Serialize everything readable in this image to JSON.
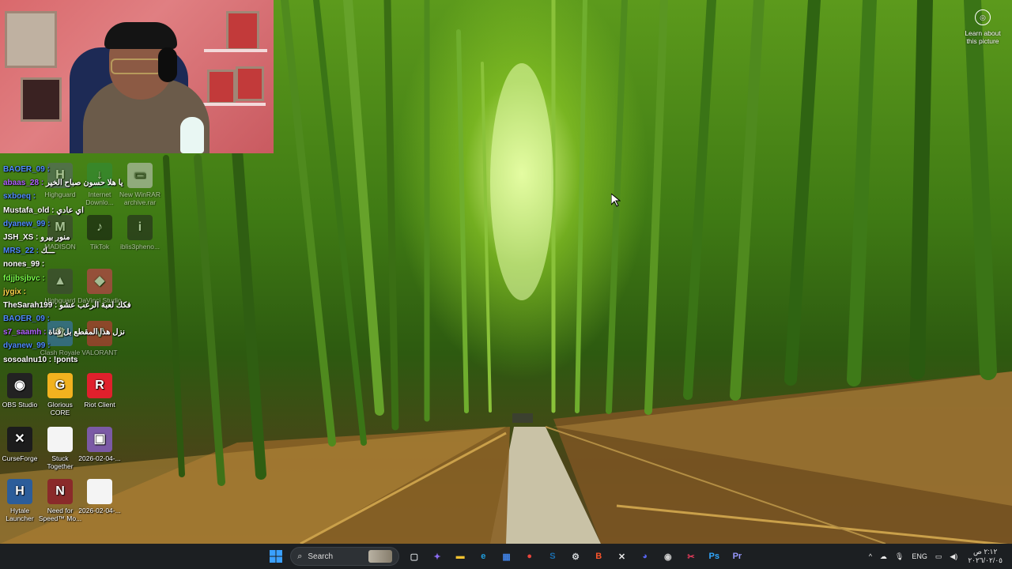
{
  "learn_about": {
    "label_line1": "Learn about",
    "label_line2": "this picture"
  },
  "chat": [
    {
      "user": "BAOER_09 :",
      "msg": "",
      "color": "#4f8bff"
    },
    {
      "user": "abaas_28 :",
      "msg": "يا هلا حسون صباح الخير",
      "color": "#b061ff"
    },
    {
      "user": "sxboeq :",
      "msg": "",
      "color": "#4f8bff"
    },
    {
      "user": "Mustafa_old :",
      "msg": "اي عادي",
      "color": "#ffffff"
    },
    {
      "user": "dyanew_99 :",
      "msg": "",
      "color": "#4f8bff"
    },
    {
      "user": "JSH_XS :",
      "msg": "منور بيرو",
      "color": "#ffffff"
    },
    {
      "user": "MRS_22 :",
      "msg": "ـــك",
      "color": "#4f8bff"
    },
    {
      "user": "nones_99 :",
      "msg": "",
      "color": "#ffffff"
    },
    {
      "user": "fdjjbsjbvc :",
      "msg": "",
      "color": "#7cff4a"
    },
    {
      "user": "jygix :",
      "msg": "",
      "color": "#ffd34a"
    },
    {
      "user": "TheSarah199 :",
      "msg": "فكك لعبة الرعب عشو",
      "color": "#ffffff"
    },
    {
      "user": "BAOER_09 :",
      "msg": "",
      "color": "#4f8bff"
    },
    {
      "user": "s7_saamh :",
      "msg": "نزل هذا المقطع بل قناة",
      "color": "#b061ff"
    },
    {
      "user": "dyanew_99 :",
      "msg": "",
      "color": "#4f8bff"
    },
    {
      "user": "sosoalnu10 :",
      "msg": "!ponts",
      "color": "#ffffff"
    }
  ],
  "desktop_icons": [
    {
      "label": "Highguard",
      "color": "#5a6470",
      "glyph": "H"
    },
    {
      "label": "Internet Downlo...",
      "color": "#2e8c3a",
      "glyph": "↓"
    },
    {
      "label": "New WinRAR archive.rar",
      "color": "#cfcfcf",
      "glyph": "▭"
    },
    {
      "label": "MADISON",
      "color": "#3a3a3a",
      "glyph": "M"
    },
    {
      "label": "TikTok",
      "color": "#111111",
      "glyph": "♪"
    },
    {
      "label": "iblis3pheno...",
      "color": "#202020",
      "glyph": "i"
    },
    {
      "label": "Highguard",
      "color": "#3f3f3f",
      "glyph": "▲"
    },
    {
      "label": "DaVinci Studio",
      "color": "#e23a5a",
      "glyph": "◆"
    },
    {
      "label": "Clash Royale",
      "color": "#3a7ad0",
      "glyph": "♛"
    },
    {
      "label": "VALORANT",
      "color": "#d8343f",
      "glyph": "V"
    },
    {
      "label": "OBS Studio",
      "color": "#222222",
      "glyph": "◉"
    },
    {
      "label": "Glorious CORE",
      "color": "#f2b21f",
      "glyph": "G"
    },
    {
      "label": "Riot Client",
      "color": "#e0202c",
      "glyph": "R"
    },
    {
      "label": "CurseForge",
      "color": "#1c1c1c",
      "glyph": "✕"
    },
    {
      "label": "Stuck Together",
      "color": "#f4f4f4",
      "glyph": ""
    },
    {
      "label": "2026-02-04-...",
      "color": "#7b5aa6",
      "glyph": "▣"
    },
    {
      "label": "Hytale Launcher",
      "color": "#2c5d9a",
      "glyph": "H"
    },
    {
      "label": "Need for Speed™ Mo...",
      "color": "#8a2a2a",
      "glyph": "N"
    },
    {
      "label": "2026-02-04-...",
      "color": "#f4f4f4",
      "glyph": ""
    }
  ],
  "taskbar": {
    "search_placeholder": "Search",
    "apps": [
      {
        "name": "task-view",
        "color": "#cfd3d6",
        "glyph": "▢"
      },
      {
        "name": "copilot",
        "color": "#8b6cf0",
        "glyph": "✦"
      },
      {
        "name": "file-explorer",
        "color": "#f2c230",
        "glyph": "▬"
      },
      {
        "name": "edge",
        "color": "#1f9ede",
        "glyph": "e"
      },
      {
        "name": "store",
        "color": "#3f7fe0",
        "glyph": "▦"
      },
      {
        "name": "chrome",
        "color": "#e8453c",
        "glyph": "●"
      },
      {
        "name": "steam",
        "color": "#1b6fb0",
        "glyph": "S"
      },
      {
        "name": "settings",
        "color": "#cfd3d6",
        "glyph": "⚙"
      },
      {
        "name": "brave",
        "color": "#fb542b",
        "glyph": "B"
      },
      {
        "name": "curseforge",
        "color": "#e9e9e9",
        "glyph": "✕"
      },
      {
        "name": "discord",
        "color": "#5865f2",
        "glyph": "◕"
      },
      {
        "name": "obs",
        "color": "#cfcfcf",
        "glyph": "◉"
      },
      {
        "name": "snipping",
        "color": "#e23a5a",
        "glyph": "✂"
      },
      {
        "name": "photoshop",
        "color": "#31a8ff",
        "glyph": "Ps"
      },
      {
        "name": "premiere",
        "color": "#9999ff",
        "glyph": "Pr"
      }
    ],
    "tray": {
      "language": "ENG",
      "time": "٢:١٢ ص",
      "date": "٢٠٢٦/٠٢/٠٥"
    }
  }
}
